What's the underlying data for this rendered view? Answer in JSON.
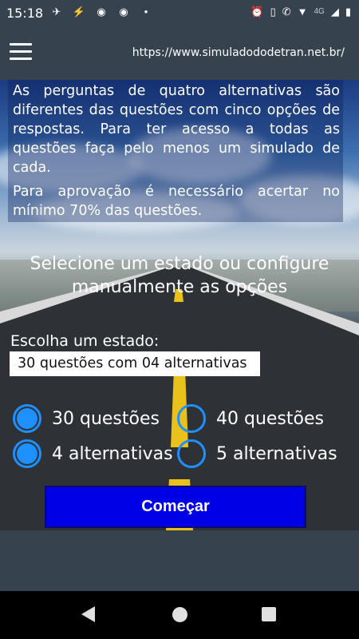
{
  "status_bar": {
    "time": "15:18",
    "network": "4G",
    "left_icons": [
      "bird-icon",
      "messenger-icon",
      "chrome-icon",
      "chrome-icon",
      "dot-icon"
    ],
    "right_icons": [
      "alarm-icon",
      "vibrate-icon",
      "wifi-call-icon",
      "wifi-icon",
      "signal-icon",
      "battery-icon"
    ]
  },
  "app_bar": {
    "url": "https://www.simuladododetran.net.br/"
  },
  "info": {
    "paragraph1": "As perguntas de quatro alternativas são diferentes das questões com cinco opções de respostas. Para ter acesso a todas as questões faça pelo menos um simulado de cada.",
    "paragraph2": "Para aprovação é necessário acertar no mínimo 70% das questões."
  },
  "headline": {
    "line1": "Selecione um estado ou configure",
    "line2": "manualmente as opções"
  },
  "state": {
    "label": "Escolha um estado:",
    "selected": "30 questões com 04 alternativas"
  },
  "options": {
    "questions": [
      {
        "label": "30 questões",
        "selected": true
      },
      {
        "label": "40 questões",
        "selected": false
      }
    ],
    "alternatives": [
      {
        "label": "4 alternativas",
        "selected": true
      },
      {
        "label": "5 alternativas",
        "selected": false
      }
    ]
  },
  "start_button": "Começar",
  "colors": {
    "accent": "#1e90ff",
    "button": "#0000e6",
    "bar": "#37424f"
  }
}
